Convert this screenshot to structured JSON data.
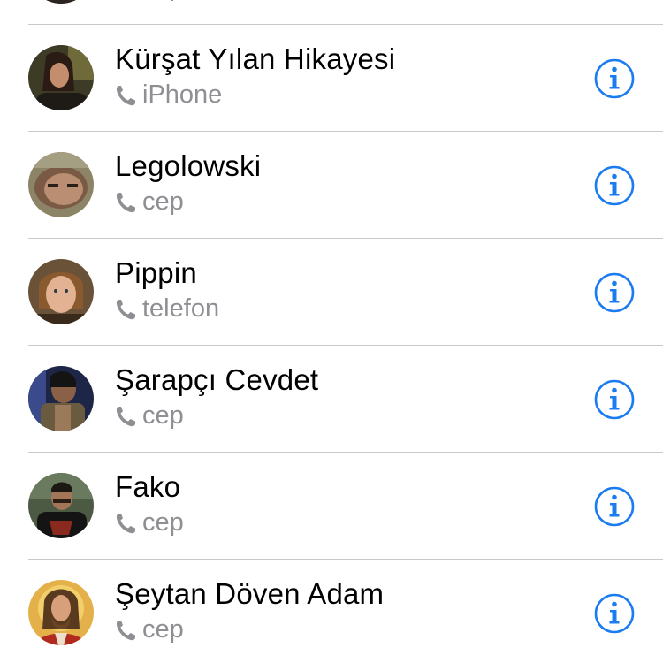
{
  "contacts": [
    {
      "name": "",
      "label": "cep",
      "avatar": "person-photo",
      "accent": "#6b4a3a"
    },
    {
      "name": "Kürşat Yılan Hikayesi",
      "label": "iPhone",
      "avatar": "person-photo",
      "accent": "#5a4a2e"
    },
    {
      "name": "Legolowski",
      "label": "cep",
      "avatar": "person-photo",
      "accent": "#7a6a4e"
    },
    {
      "name": "Pippin",
      "label": "telefon",
      "avatar": "person-photo",
      "accent": "#8a6a4a"
    },
    {
      "name": "Şarapçı Cevdet",
      "label": "cep",
      "avatar": "person-photo",
      "accent": "#3a3f6a"
    },
    {
      "name": "Fako",
      "label": "cep",
      "avatar": "person-photo",
      "accent": "#3e4a3a"
    },
    {
      "name": "Şeytan Döven Adam",
      "label": "cep",
      "avatar": "person-photo",
      "accent": "#d9a441"
    }
  ],
  "icons": {
    "phone": "phone-icon",
    "info": "info-icon"
  },
  "colors": {
    "tint": "#1a7cf0",
    "subtitle": "#8e8e93",
    "separator": "#c8c7cc"
  }
}
